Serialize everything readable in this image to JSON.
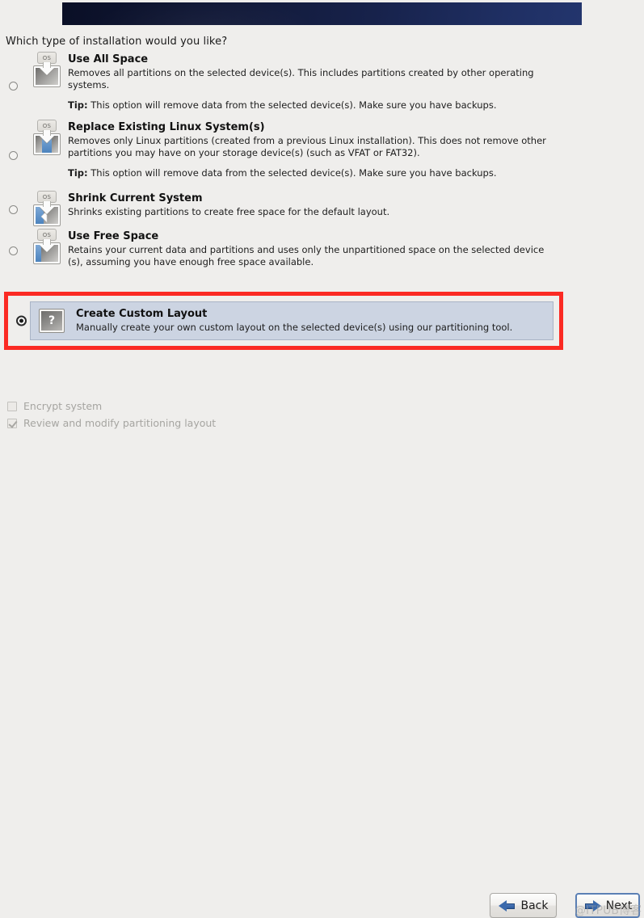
{
  "header": {
    "banner_alt": "installer-banner",
    "question": "Which type of installation would you like?"
  },
  "options": [
    {
      "title": "Use All Space",
      "desc": "Removes all partitions on the selected device(s).  This includes partitions created by other operating systems.",
      "tip_label": "Tip:",
      "tip": " This option will remove data from the selected device(s).  Make sure you have backups.",
      "selected": false,
      "icon": "disk-all-grey-icon",
      "os_tag": "OS"
    },
    {
      "title": "Replace Existing Linux System(s)",
      "desc": "Removes only Linux partitions (created from a previous Linux installation).  This does not remove other partitions you may have on your storage device(s) (such as VFAT or FAT32).",
      "tip_label": "Tip:",
      "tip": " This option will remove data from the selected device(s).  Make sure you have backups.",
      "selected": false,
      "icon": "disk-replace-linux-icon",
      "os_tag": "OS"
    },
    {
      "title": "Shrink Current System",
      "desc": "Shrinks existing partitions to create free space for the default layout.",
      "tip_label": "",
      "tip": "",
      "selected": false,
      "icon": "disk-shrink-icon",
      "os_tag": "OS"
    },
    {
      "title": "Use Free Space",
      "desc": "Retains your current data and partitions and uses only the unpartitioned space on the selected device (s), assuming you have enough free space available.",
      "tip_label": "",
      "tip": "",
      "selected": false,
      "icon": "disk-free-space-icon",
      "os_tag": "OS"
    }
  ],
  "selected_option": {
    "title": "Create Custom Layout",
    "desc": "Manually create your own custom layout on the selected device(s) using our partitioning tool.",
    "icon": "question-mark-icon",
    "icon_glyph": "?",
    "selected": true,
    "highlight_color": "#fb2a23",
    "panel_color": "#ccd4e2"
  },
  "checkboxes": [
    {
      "label": "Encrypt system",
      "checked": false,
      "enabled": false
    },
    {
      "label": "Review and modify partitioning layout",
      "checked": true,
      "enabled": false
    }
  ],
  "buttons": {
    "back": {
      "label": "Back",
      "icon": "arrow-left-icon"
    },
    "next": {
      "label": "Next",
      "icon": "arrow-right-icon",
      "focused": true
    }
  },
  "watermark": "@ITPUB博客",
  "colors": {
    "background": "#efeeec",
    "banner_left": "#0a0f26",
    "banner_right": "#23356d",
    "highlight_red": "#fb2a23",
    "selection_blue": "#ccd4e2",
    "focus_border": "#5a7fb4"
  }
}
